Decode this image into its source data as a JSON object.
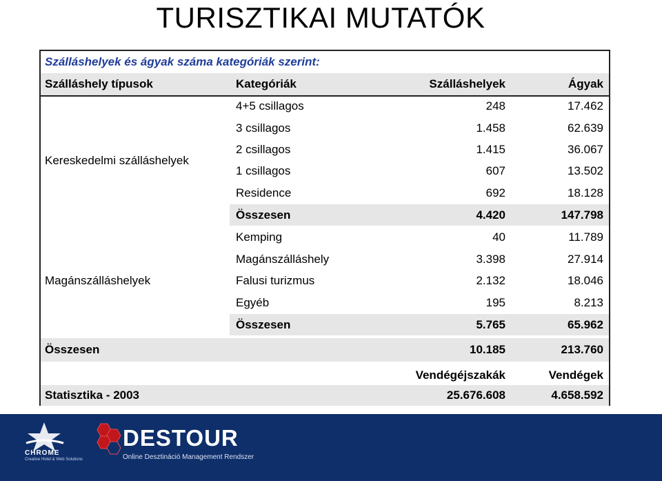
{
  "title": "TURISZTIKAI MUTATÓK",
  "table": {
    "heading": "Szálláshelyek és ágyak száma kategóriák szerint:",
    "columns": [
      "Szálláshely típusok",
      "Kategóriák",
      "Szálláshelyek",
      "Ágyak"
    ],
    "groups": [
      {
        "label": "Kereskedelmi szálláshelyek",
        "rows": [
          {
            "category": "4+5 csillagos",
            "places": "248",
            "beds": "17.462"
          },
          {
            "category": "3 csillagos",
            "places": "1.458",
            "beds": "62.639"
          },
          {
            "category": "2 csillagos",
            "places": "1.415",
            "beds": "36.067"
          },
          {
            "category": "1 csillagos",
            "places": "607",
            "beds": "13.502"
          },
          {
            "category": "Residence",
            "places": "692",
            "beds": "18.128"
          }
        ],
        "total": {
          "category": "Összesen",
          "places": "4.420",
          "beds": "147.798"
        }
      },
      {
        "label": "Magánszálláshelyek",
        "rows": [
          {
            "category": "Kemping",
            "places": "40",
            "beds": "11.789"
          },
          {
            "category": "Magánszálláshely",
            "places": "3.398",
            "beds": "27.914"
          },
          {
            "category": "Falusi turizmus",
            "places": "2.132",
            "beds": "18.046"
          },
          {
            "category": "Egyéb",
            "places": "195",
            "beds": "8.213"
          }
        ],
        "total": {
          "category": "Összesen",
          "places": "5.765",
          "beds": "65.962"
        }
      }
    ],
    "grand_total": {
      "label": "Összesen",
      "places": "10.185",
      "beds": "213.760"
    },
    "stats": {
      "headers": [
        "Vendégéjszakák",
        "Vendégek"
      ],
      "label": "Statisztika - 2003",
      "values": [
        "25.676.608",
        "4.658.592"
      ]
    }
  },
  "footer": {
    "chrome_logo": "CHROME",
    "chrome_sub": "Creative Hotel & Web Solutions",
    "destour_logo": "DESTOUR",
    "destour_sub": "Online Desztináció Management Rendszer"
  },
  "colors": {
    "heading": "#1f3d99",
    "row_shade": "#e6e6e6",
    "footer_bg": "#0f2f6a"
  }
}
